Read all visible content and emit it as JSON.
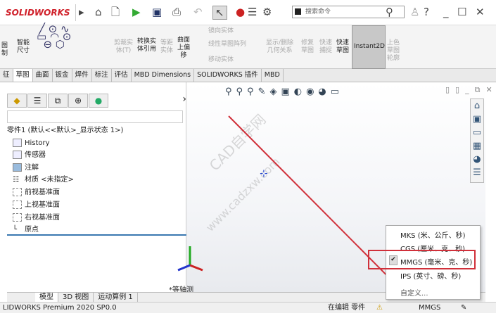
{
  "app": {
    "logo": "SOLIDWORKS",
    "search_placeholder": "搜索命令"
  },
  "ribbon": {
    "items": [
      "图\n制",
      "智能\n尺寸",
      "剪裁实\n体(T)",
      "转换实\n体引用",
      "等距\n实体",
      "曲面\n上偏\n移",
      "镜向实体",
      "线性草图阵列",
      "移动实体",
      "显示/删除\n几何关系",
      "修复\n草图",
      "快速\n捕捉",
      "快速\n草图",
      "Instant2D",
      "上色\n草图\n轮廓"
    ]
  },
  "tabs": [
    "征",
    "草图",
    "曲面",
    "钣金",
    "焊件",
    "标注",
    "评估",
    "MBD Dimensions",
    "SOLIDWORKS 插件",
    "MBD"
  ],
  "tree": {
    "root": "零件1 (默认<<默认>_显示状态 1>)",
    "items": [
      "History",
      "传感器",
      "注解",
      "材质 <未指定>",
      "前视基准面",
      "上视基准面",
      "右视基准面",
      "原点"
    ]
  },
  "view": {
    "label": "*等轴测",
    "watermark": "CAD自学网",
    "watermark_url": "www.cadzxw.com"
  },
  "units_menu": {
    "items": [
      "MKS (米、公斤、秒)",
      "CGS (厘米、克、秒)",
      "MMGS (毫米、克、秒)",
      "IPS (英寸、磅、秒)",
      "自定义..."
    ],
    "selected": "MMGS (毫米、克、秒)"
  },
  "bottom_tabs": [
    "模型",
    "3D 视图",
    "运动算例 1"
  ],
  "status": {
    "product": "LIDWORKS Premium 2020 SP0.0",
    "mode": "在编辑 零件",
    "units": "MMGS"
  },
  "colors": {
    "accent": "#d0303a"
  }
}
